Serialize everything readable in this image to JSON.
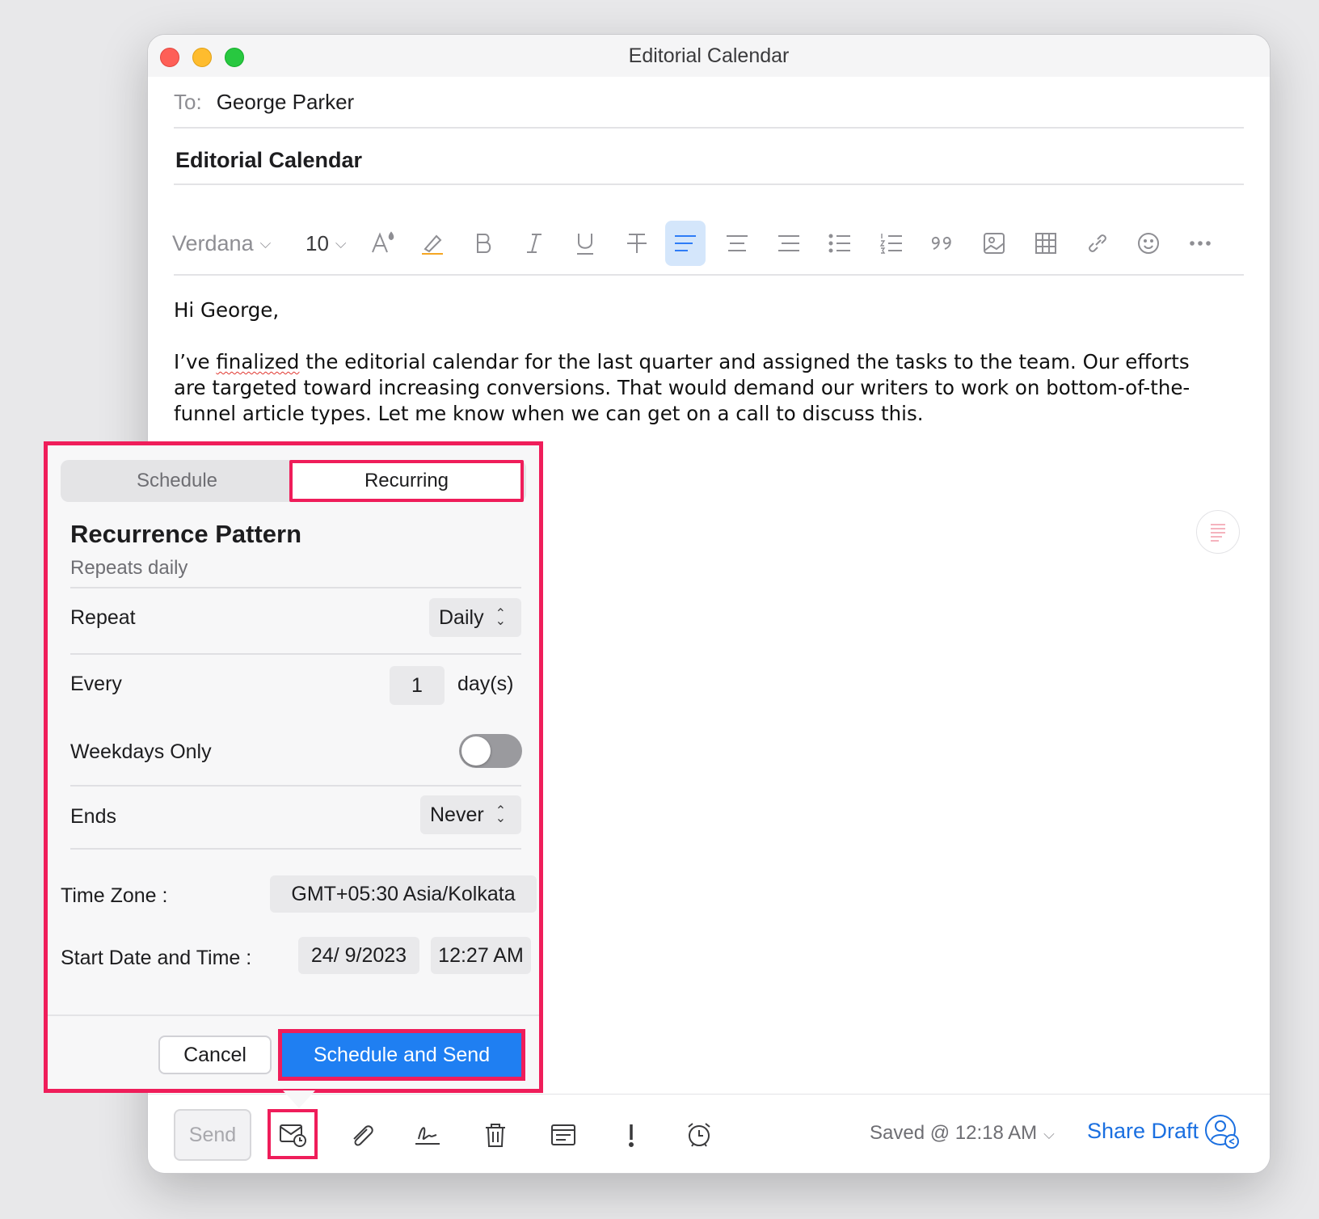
{
  "window": {
    "title": "Editorial Calendar"
  },
  "compose": {
    "to_label": "To:",
    "to_value": "George Parker",
    "subject": "Editorial Calendar",
    "font_name": "Verdana",
    "font_size": "10",
    "body": {
      "greeting": "Hi George,",
      "p_before": "I’ve ",
      "misspelled": "finalized",
      "p_after": " the editorial calendar for the last quarter and assigned the tasks to the team. Our efforts are targeted toward increasing conversions. That would demand our writers to work on bottom-of-the-funnel article types. Let me know when we can get on a call to discuss this."
    }
  },
  "popover": {
    "tabs": {
      "schedule": "Schedule",
      "recurring": "Recurring"
    },
    "title": "Recurrence Pattern",
    "subtitle": "Repeats daily",
    "repeat_label": "Repeat",
    "repeat_value": "Daily",
    "every_label": "Every",
    "every_value": "1",
    "every_unit": "day(s)",
    "weekdays_label": "Weekdays Only",
    "weekdays_on": false,
    "ends_label": "Ends",
    "ends_value": "Never",
    "timezone_label": "Time Zone :",
    "timezone_value": "GMT+05:30 Asia/Kolkata",
    "start_label": "Start Date and Time :",
    "start_date": "24/ 9/2023",
    "start_time": "12:27 AM",
    "cancel": "Cancel",
    "schedule_send": "Schedule and Send"
  },
  "bottom_bar": {
    "send": "Send",
    "saved": "Saved @ 12:18 AM",
    "share_draft": "Share Draft"
  },
  "colors": {
    "highlight": "#ef1d5a",
    "accent": "#1f7ff2",
    "link": "#1a6fe0"
  }
}
